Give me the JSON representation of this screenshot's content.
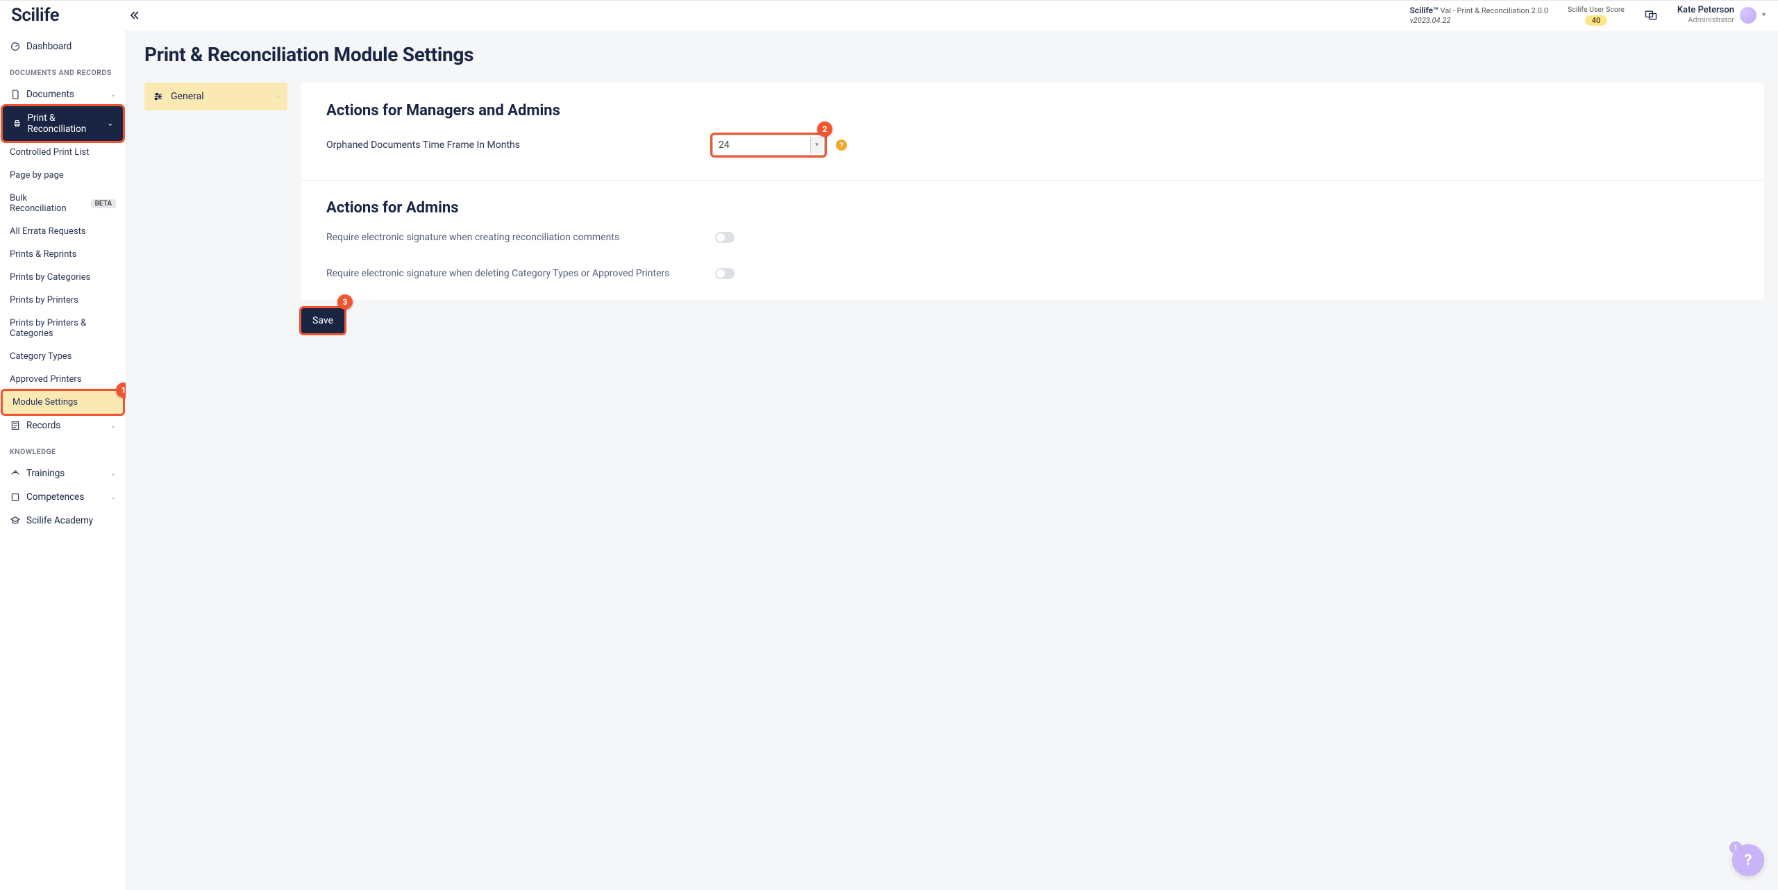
{
  "brand": "Scilife",
  "header": {
    "product_name": "Scilife™",
    "product_desc": "Val - Print & Reconciliation 2.0.0",
    "product_version": "v2023.04.22",
    "score_label": "Scilife User Score",
    "score_value": "40",
    "user_name": "Kate Peterson",
    "user_role": "Administrator"
  },
  "sidebar": {
    "dashboard": "Dashboard",
    "section1": "DOCUMENTS AND RECORDS",
    "documents": "Documents",
    "print_recon": "Print & Reconciliation",
    "sub": {
      "controlled_print_list": "Controlled Print List",
      "page_by_page": "Page by page",
      "bulk_recon": "Bulk Reconciliation",
      "bulk_recon_badge": "BETA",
      "errata": "All Errata Requests",
      "prints_reprints": "Prints & Reprints",
      "prints_cats": "Prints by Categories",
      "prints_printers": "Prints by Printers",
      "prints_both": "Prints by Printers & Categories",
      "cat_types": "Category Types",
      "approved_printers": "Approved Printers",
      "module_settings": "Module Settings"
    },
    "records": "Records",
    "section2": "KNOWLEDGE",
    "trainings": "Trainings",
    "competences": "Competences",
    "academy": "Scilife Academy"
  },
  "page": {
    "title": "Print & Reconciliation Module Settings",
    "tab_general": "General",
    "section_managers": "Actions for Managers and Admins",
    "orphaned_label": "Orphaned Documents Time Frame In Months",
    "orphaned_value": "24",
    "section_admins": "Actions for Admins",
    "toggle1_label": "Require electronic signature when creating reconciliation comments",
    "toggle2_label": "Require electronic signature when deleting Category Types or Approved Printers",
    "save": "Save"
  },
  "annotations": {
    "a1": "1",
    "a2": "2",
    "a3": "3"
  },
  "fab_badge": "1"
}
